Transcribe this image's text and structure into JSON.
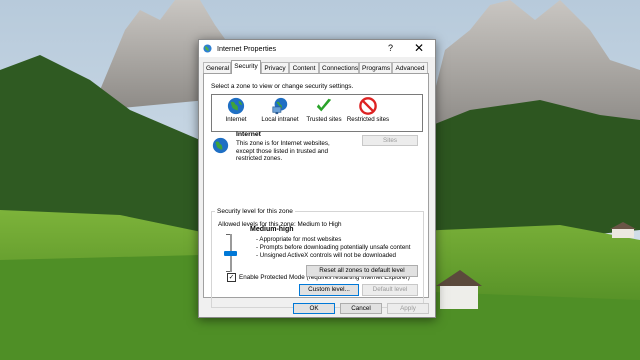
{
  "window": {
    "title": "Internet Properties",
    "help_glyph": "?",
    "close_glyph": "✕",
    "icon": "internet-globe-icon"
  },
  "tabs": [
    {
      "label": "General",
      "active": false
    },
    {
      "label": "Security",
      "active": true
    },
    {
      "label": "Privacy",
      "active": false
    },
    {
      "label": "Content",
      "active": false
    },
    {
      "label": "Connections",
      "active": false
    },
    {
      "label": "Programs",
      "active": false
    },
    {
      "label": "Advanced",
      "active": false
    }
  ],
  "security": {
    "zone_prompt": "Select a zone to view or change security settings.",
    "zones": [
      {
        "label": "Internet",
        "icon": "globe-icon",
        "selected": true
      },
      {
        "label": "Local intranet",
        "icon": "intranet-globe-icon",
        "selected": false
      },
      {
        "label": "Trusted sites",
        "icon": "checkmark-icon",
        "selected": false
      },
      {
        "label": "Restricted sites",
        "icon": "no-entry-icon",
        "selected": false
      }
    ],
    "selected_zone": {
      "title": "Internet",
      "description": "This zone is for Internet websites, except those listed in trusted and restricted zones."
    },
    "sites_button": "Sites",
    "group_title": "Security level for this zone",
    "allowed_levels": "Allowed levels for this zone: Medium to High",
    "level_name": "Medium-high",
    "level_lines": [
      "- Appropriate for most websites",
      "- Prompts before downloading potentially unsafe content",
      "- Unsigned ActiveX controls will not be downloaded"
    ],
    "slider_level_index": 1,
    "slider_level_count": 3,
    "protected_mode_label": "Enable Protected Mode (requires restarting Internet Explorer)",
    "protected_mode_checked": true,
    "custom_level_button": "Custom level...",
    "default_level_button": "Default level",
    "reset_all_button": "Reset all zones to default level"
  },
  "footer": {
    "ok": "OK",
    "cancel": "Cancel",
    "apply": "Apply"
  },
  "colors": {
    "accent": "#0078d7",
    "dialog_bg": "#f0f0f0",
    "sky": "#c9d8e6",
    "meadow": "#5a9a2a"
  }
}
